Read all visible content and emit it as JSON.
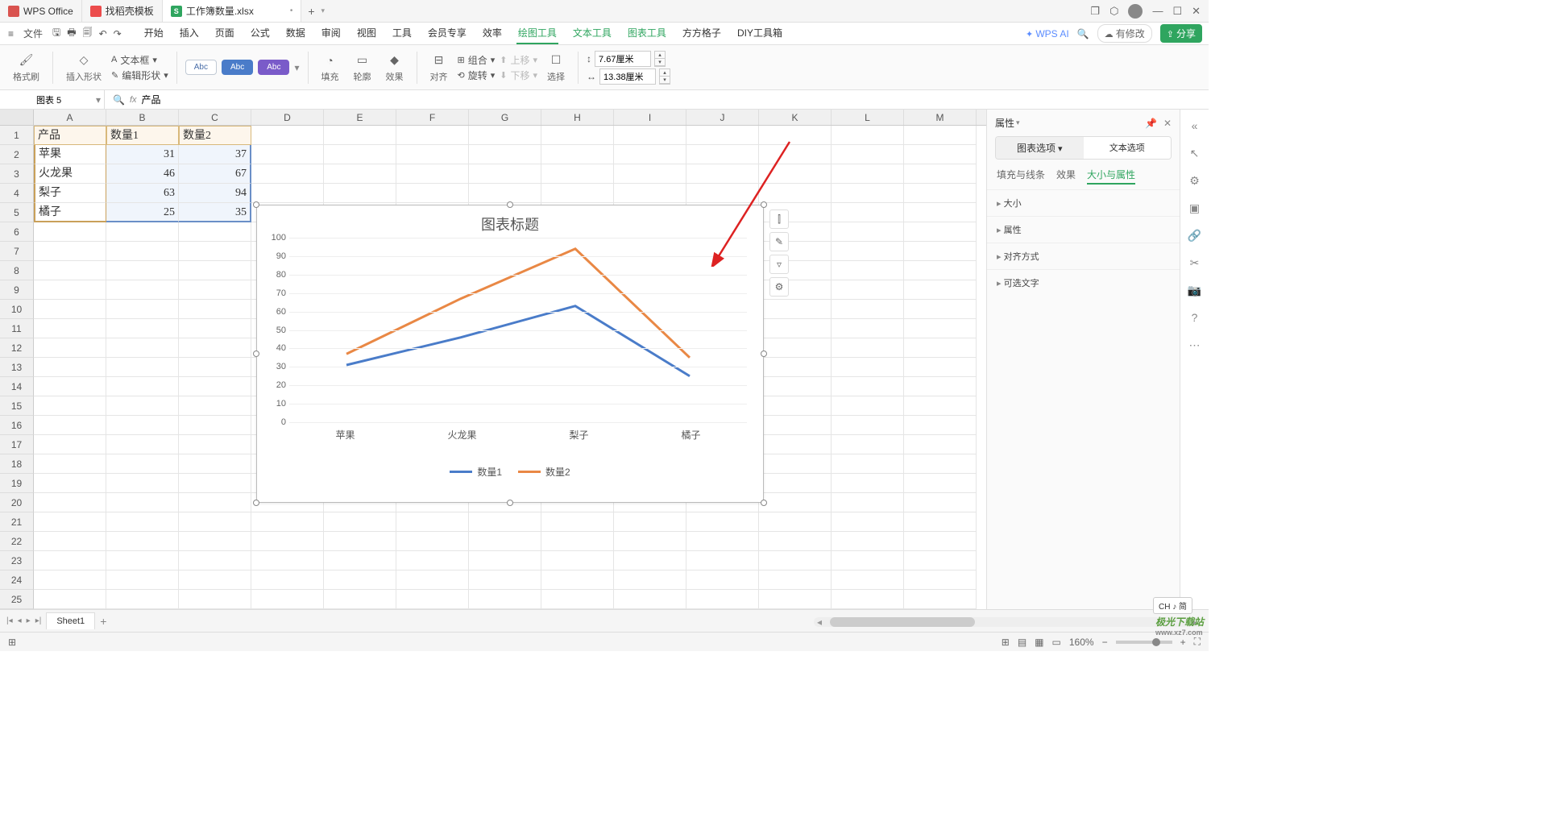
{
  "titlebar": {
    "tabs": [
      {
        "label": "WPS Office"
      },
      {
        "label": "找稻壳模板"
      },
      {
        "label": "工作簿数量.xlsx"
      }
    ],
    "close_glyph": "•",
    "add": "+"
  },
  "menubar": {
    "file": "文件",
    "tabs": [
      "开始",
      "插入",
      "页面",
      "公式",
      "数据",
      "审阅",
      "视图",
      "工具",
      "会员专享",
      "效率",
      "绘图工具",
      "文本工具",
      "图表工具",
      "方方格子",
      "DIY工具箱"
    ],
    "active_tab": "绘图工具",
    "wpsai": "WPS AI",
    "modify": "有修改",
    "share": "分享"
  },
  "ribbon": {
    "format_brush": "格式刷",
    "insert_shape": "插入形状",
    "textbox": "文本框",
    "edit_shape": "编辑形状",
    "abc1": "Abc",
    "abc2": "Abc",
    "abc3": "Abc",
    "fill": "填充",
    "outline": "轮廓",
    "effect": "效果",
    "align": "对齐",
    "group": "组合",
    "rotate": "旋转",
    "up": "上移",
    "down": "下移",
    "select": "选择",
    "height_icon": "↕",
    "width_icon": "↔",
    "height_val": "7.67厘米",
    "width_val": "13.38厘米"
  },
  "namebox": {
    "value": "图表 5",
    "formula": "产品",
    "fx": "fx"
  },
  "columns": [
    "A",
    "B",
    "C",
    "D",
    "E",
    "F",
    "G",
    "H",
    "I",
    "J",
    "K",
    "L",
    "M"
  ],
  "table": {
    "headers": [
      "产品",
      "数量1",
      "数量2"
    ],
    "rows": [
      [
        "苹果",
        "31",
        "37"
      ],
      [
        "火龙果",
        "46",
        "67"
      ],
      [
        "梨子",
        "63",
        "94"
      ],
      [
        "橘子",
        "25",
        "35"
      ]
    ]
  },
  "chart": {
    "title": "图表标题",
    "yticks": [
      "100",
      "90",
      "80",
      "70",
      "60",
      "50",
      "40",
      "30",
      "20",
      "10",
      "0"
    ],
    "categories": [
      "苹果",
      "火龙果",
      "梨子",
      "橘子"
    ],
    "legend": [
      "数量1",
      "数量2"
    ]
  },
  "chart_data": {
    "type": "line",
    "title": "图表标题",
    "categories": [
      "苹果",
      "火龙果",
      "梨子",
      "橘子"
    ],
    "series": [
      {
        "name": "数量1",
        "values": [
          31,
          46,
          63,
          25
        ],
        "color": "#4a7cc9"
      },
      {
        "name": "数量2",
        "values": [
          37,
          67,
          94,
          35
        ],
        "color": "#e98845"
      }
    ],
    "ylim": [
      0,
      100
    ],
    "xlabel": "",
    "ylabel": ""
  },
  "panel": {
    "title": "属性",
    "tabs": [
      "图表选项",
      "文本选项"
    ],
    "subtabs": [
      "填充与线条",
      "效果",
      "大小与属性"
    ],
    "sections": [
      "大小",
      "属性",
      "对齐方式",
      "可选文字"
    ]
  },
  "sheet_tabs": {
    "sheet1": "Sheet1"
  },
  "statusbar": {
    "zoom": "160%",
    "ime": "CH ♪ 简"
  },
  "watermark": {
    "brand": "极光下载站",
    "url": "www.xz7.com"
  }
}
